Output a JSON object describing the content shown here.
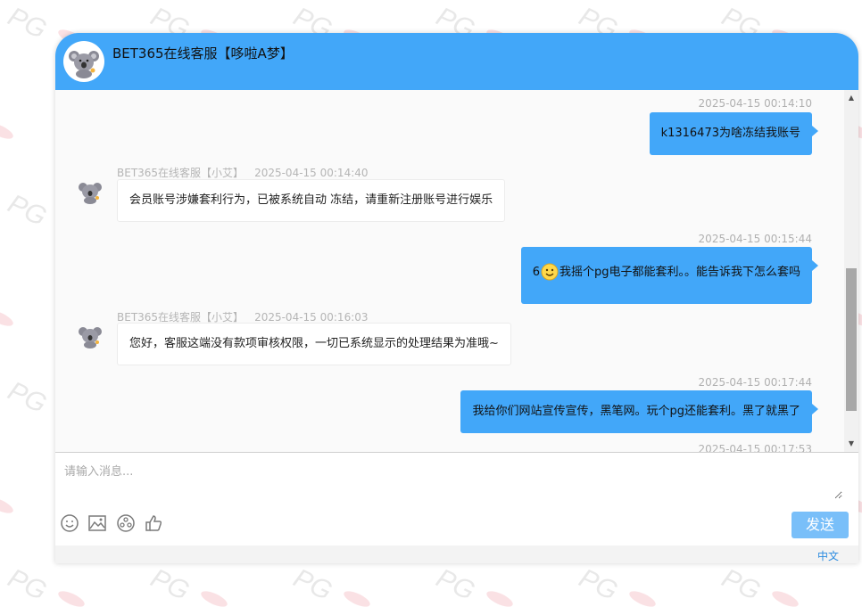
{
  "header": {
    "title": "BET365在线客服【哆啦A梦】",
    "avatar_icon": "koala-avatar-icon",
    "background_color": "#42a7f9"
  },
  "messages": [
    {
      "direction": "out",
      "time": "2025-04-15 00:14:10",
      "text": "k1316473为啥冻结我账号"
    },
    {
      "direction": "in",
      "sender": "BET365在线客服【小艾】",
      "time": "2025-04-15 00:14:40",
      "text": "会员账号涉嫌套利行为，已被系统自动 冻结，请重新注册账号进行娱乐"
    },
    {
      "direction": "out",
      "time": "2025-04-15 00:15:44",
      "text_prefix": "6",
      "emoji": "smiley-emoji",
      "text": "我摇个pg电子都能套利。。能告诉我下怎么套吗"
    },
    {
      "direction": "in",
      "sender": "BET365在线客服【小艾】",
      "time": "2025-04-15 00:16:03",
      "text": "您好，客服这端没有款项审核权限，一切已系统显示的处理结果为准哦~"
    },
    {
      "direction": "out",
      "time": "2025-04-15 00:17:44",
      "text": "我给你们网站宣传宣传，黑笔网。玩个pg还能套利。黑了就黑了"
    },
    {
      "direction": "out",
      "time": "2025-04-15 00:17:53",
      "text": ""
    }
  ],
  "input": {
    "placeholder": "请输入消息..."
  },
  "toolbar": {
    "icons": [
      "emoji-icon",
      "image-icon",
      "video-icon",
      "thumbs-up-icon"
    ],
    "send_label": "发送"
  },
  "footer": {
    "language": "中文"
  },
  "colors": {
    "accent": "#42a7f9",
    "send_button": "#79bff9",
    "link": "#2a8be0"
  }
}
